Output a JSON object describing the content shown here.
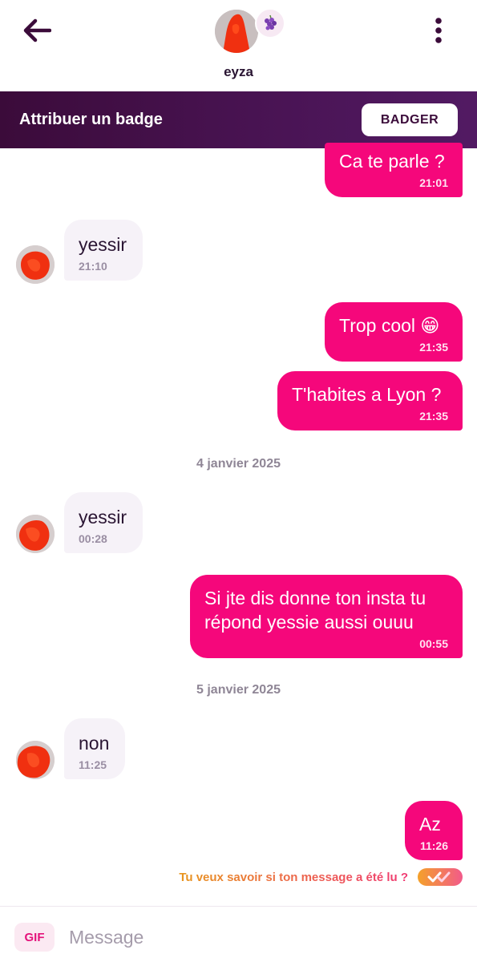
{
  "header": {
    "contact_name": "eyza",
    "back_icon": "arrow-left-icon",
    "menu_icon": "more-vertical-icon",
    "badge_icon": "grapes-icon"
  },
  "banner": {
    "title": "Attribuer un badge",
    "button_label": "BADGER"
  },
  "messages": [
    {
      "dir": "out",
      "text": "Ca te parle ?",
      "time": "21:01"
    },
    {
      "dir": "in",
      "text": "yessir",
      "time": "21:10"
    },
    {
      "dir": "out",
      "text": "Trop cool 😁",
      "time": "21:35"
    },
    {
      "dir": "out",
      "text": "T'habites a Lyon ?",
      "time": "21:35"
    },
    {
      "dir": "date",
      "text": "4 janvier 2025"
    },
    {
      "dir": "in",
      "text": "yessir",
      "time": "00:28"
    },
    {
      "dir": "out",
      "text": "Si jte dis donne ton insta tu répond yessie aussi ouuu",
      "time": "00:55"
    },
    {
      "dir": "date",
      "text": "5 janvier 2025"
    },
    {
      "dir": "in",
      "text": "non",
      "time": "11:25"
    },
    {
      "dir": "out",
      "text": "Az",
      "time": "11:26"
    }
  ],
  "read_receipt_prompt": "Tu veux savoir si ton message a été lu ?",
  "composer": {
    "gif_label": "GIF",
    "placeholder": "Message"
  },
  "colors": {
    "outgoing_bubble": "#f5077b",
    "incoming_bubble": "#f6f2f8",
    "banner": "#4a1455",
    "text_dark": "#2a1533"
  }
}
